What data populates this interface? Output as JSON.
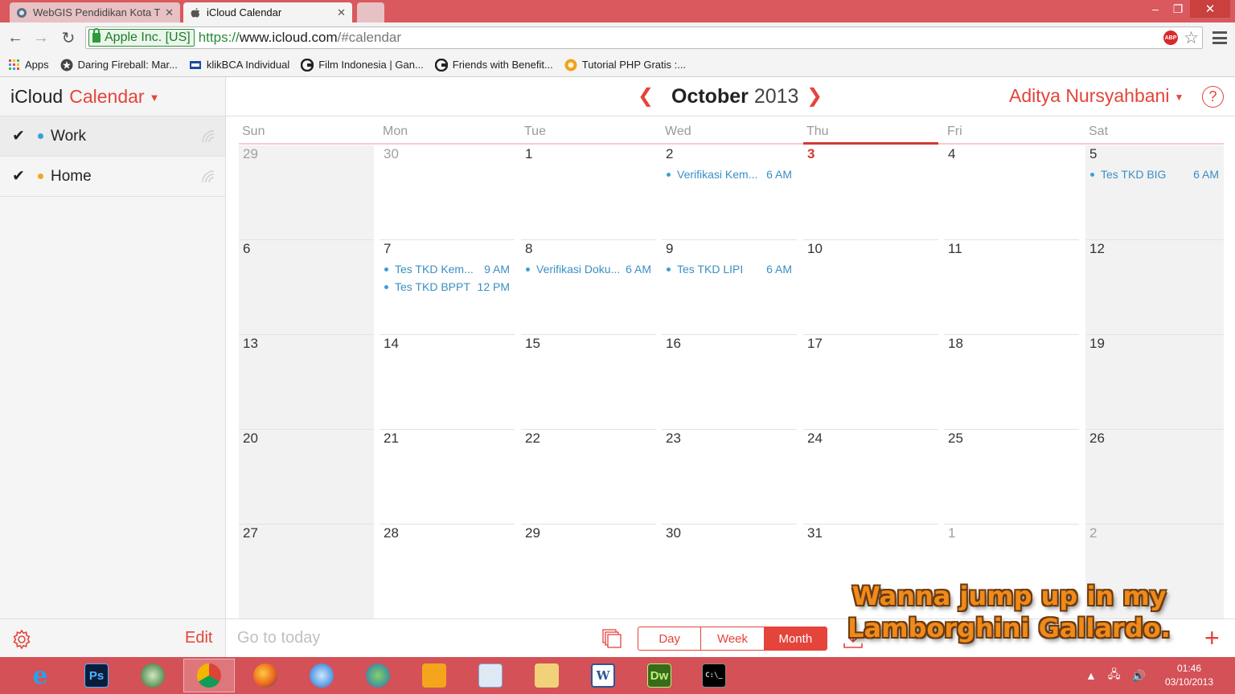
{
  "browser": {
    "tabs": [
      {
        "title": "WebGIS Pendidikan Kota T",
        "favicon": "globe-icon",
        "active": false
      },
      {
        "title": "iCloud Calendar",
        "favicon": "apple-icon",
        "active": true
      }
    ],
    "omnibox": {
      "ev_label": "Apple Inc. [US]",
      "url_scheme": "https://",
      "url_host": "www.icloud.com",
      "url_path": "/#calendar"
    },
    "bookmarks": [
      {
        "label": "Apps",
        "icon": "apps-grid-icon"
      },
      {
        "label": "Daring Fireball: Mar...",
        "icon": "star-circle-icon"
      },
      {
        "label": "klikBCA Individual",
        "icon": "bank-icon"
      },
      {
        "label": "Film Indonesia | Gan...",
        "icon": "film-icon"
      },
      {
        "label": "Friends with Benefit...",
        "icon": "film-icon"
      },
      {
        "label": "Tutorial PHP Gratis :...",
        "icon": "php-icon"
      }
    ]
  },
  "calendar": {
    "brand": {
      "icloud": "iCloud",
      "calendar": "Calendar"
    },
    "calendars": [
      {
        "name": "Work",
        "color": "#3a9fd6",
        "checked": true,
        "selected": true
      },
      {
        "name": "Home",
        "color": "#f5a623",
        "checked": true,
        "selected": false
      }
    ],
    "sidebar_footer": {
      "edit": "Edit"
    },
    "header": {
      "month": "October",
      "year": "2013",
      "user": "Aditya Nursyahbani",
      "help": "?"
    },
    "weekdays": [
      "Sun",
      "Mon",
      "Tue",
      "Wed",
      "Thu",
      "Fri",
      "Sat"
    ],
    "today_column": 4,
    "weeks": [
      [
        {
          "d": "29",
          "muted": true
        },
        {
          "d": "30",
          "muted": true
        },
        {
          "d": "1"
        },
        {
          "d": "2",
          "events": [
            {
              "title": "Verifikasi Kem...",
              "time": "6 AM"
            }
          ]
        },
        {
          "d": "3",
          "today": true
        },
        {
          "d": "4"
        },
        {
          "d": "5",
          "events": [
            {
              "title": "Tes TKD BIG",
              "time": "6 AM"
            }
          ]
        }
      ],
      [
        {
          "d": "6"
        },
        {
          "d": "7",
          "events": [
            {
              "title": "Tes TKD Kem...",
              "time": "9 AM"
            },
            {
              "title": "Tes TKD BPPT",
              "time": "12 PM"
            }
          ]
        },
        {
          "d": "8",
          "events": [
            {
              "title": "Verifikasi Doku...",
              "time": "6 AM"
            }
          ]
        },
        {
          "d": "9",
          "events": [
            {
              "title": "Tes TKD LIPI",
              "time": "6 AM"
            }
          ]
        },
        {
          "d": "10"
        },
        {
          "d": "11"
        },
        {
          "d": "12"
        }
      ],
      [
        {
          "d": "13"
        },
        {
          "d": "14"
        },
        {
          "d": "15"
        },
        {
          "d": "16"
        },
        {
          "d": "17"
        },
        {
          "d": "18"
        },
        {
          "d": "19"
        }
      ],
      [
        {
          "d": "20"
        },
        {
          "d": "21"
        },
        {
          "d": "22"
        },
        {
          "d": "23"
        },
        {
          "d": "24"
        },
        {
          "d": "25"
        },
        {
          "d": "26"
        }
      ],
      [
        {
          "d": "27"
        },
        {
          "d": "28"
        },
        {
          "d": "29"
        },
        {
          "d": "30"
        },
        {
          "d": "31"
        },
        {
          "d": "1",
          "muted": true
        },
        {
          "d": "2",
          "muted": true
        }
      ]
    ],
    "footer": {
      "go_today": "Go to today",
      "views": [
        "Day",
        "Week",
        "Month"
      ],
      "active_view": "Month"
    },
    "accent": "#e4443a",
    "event_color": "#3a8fc4"
  },
  "overlay": {
    "line1": "Wanna jump up in my",
    "line2": "Lamborghini Gallardo."
  },
  "taskbar": {
    "apps": [
      {
        "name": "internet-explorer-icon",
        "label": "e"
      },
      {
        "name": "photoshop-icon",
        "label": "Ps"
      },
      {
        "name": "search-app-icon",
        "label": ""
      },
      {
        "name": "chrome-icon",
        "label": "",
        "active": true
      },
      {
        "name": "firefox-icon",
        "label": ""
      },
      {
        "name": "itunes-icon",
        "label": ""
      },
      {
        "name": "earth-icon",
        "label": ""
      },
      {
        "name": "music-icon",
        "label": ""
      },
      {
        "name": "control-panel-icon",
        "label": ""
      },
      {
        "name": "file-explorer-icon",
        "label": ""
      },
      {
        "name": "word-icon",
        "label": "W"
      },
      {
        "name": "dreamweaver-icon",
        "label": "Dw"
      },
      {
        "name": "command-prompt-icon",
        "label": "C:\\_"
      }
    ],
    "clock": {
      "time": "01:46",
      "date": "03/10/2013"
    }
  }
}
